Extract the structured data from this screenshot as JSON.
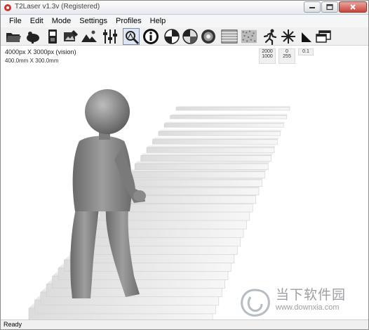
{
  "window": {
    "title": "T2Laser v1.3v (Registered)"
  },
  "menu": [
    {
      "label": "File"
    },
    {
      "label": "Edit"
    },
    {
      "label": "Mode"
    },
    {
      "label": "Settings"
    },
    {
      "label": "Profiles"
    },
    {
      "label": "Help"
    }
  ],
  "toolbar": {
    "icons": [
      "open-folder-icon",
      "save-icon",
      "export-icon",
      "image-edit-icon",
      "landscape-image-icon",
      "sliders-icon",
      "zoom-icon",
      "info-icon",
      "dither-icon",
      "contrast-pie-icon",
      "grayscale-icon",
      "line-pattern-icon",
      "noise-pattern-icon",
      "run-icon",
      "burst-icon",
      "triangle-icon",
      "windows-icon"
    ],
    "pressed": "zoom-icon"
  },
  "info": {
    "pixel_size": "4000px X 3000px  (vision)",
    "mm_size": "400.0mm X 300.0mm",
    "stats": {
      "col1_top": "2000",
      "col1_bottom": "1000",
      "col2_top": "0",
      "col2_bottom": "255",
      "col3_top": "0.1"
    }
  },
  "status": {
    "text": "Ready"
  },
  "watermark": {
    "cn_text": "当下软件园",
    "url": "www.downxia.com"
  }
}
